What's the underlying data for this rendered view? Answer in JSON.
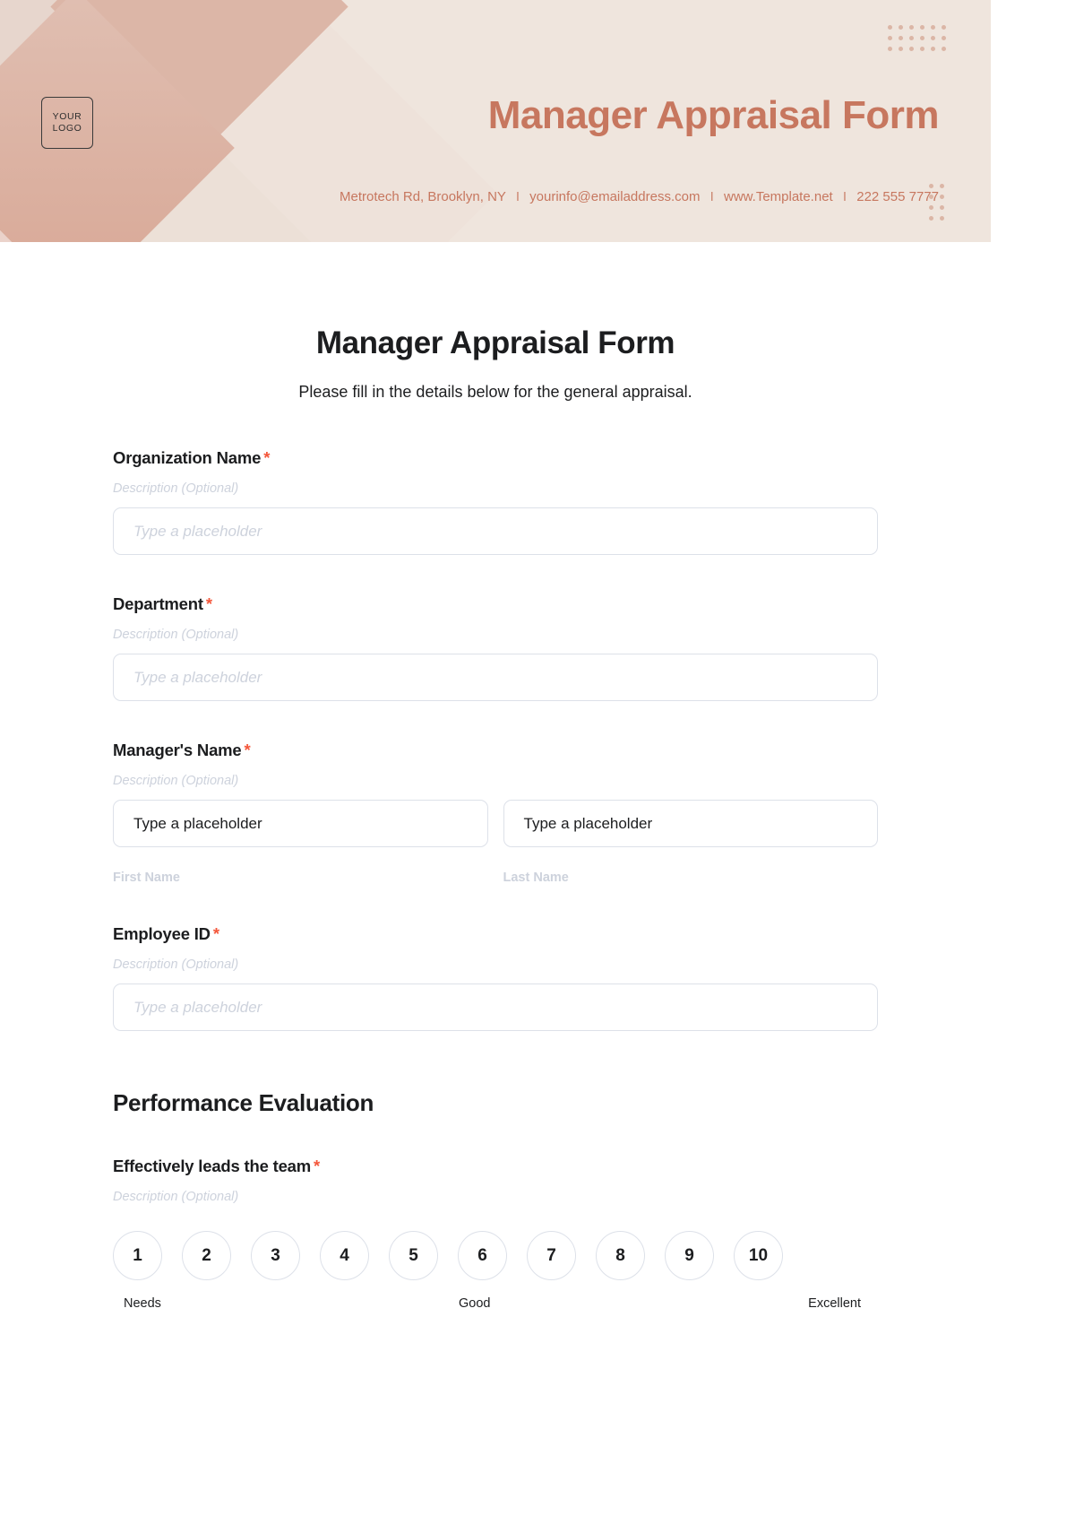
{
  "header": {
    "logo_line1": "YOUR",
    "logo_line2": "LOGO",
    "title": "Manager Appraisal Form",
    "contact": {
      "address": "Metrotech Rd, Brooklyn, NY",
      "email": "yourinfo@emailaddress.com",
      "website": "www.Template.net",
      "phone": "222 555 7777",
      "separator": "I"
    },
    "colors": {
      "accent": "#c7775f",
      "background": "#efe5de",
      "rose": "#ddb2a4",
      "dot": "#dbb6a6"
    }
  },
  "form": {
    "title": "Manager Appraisal Form",
    "subtitle": "Please fill in the details below for the general appraisal.",
    "required_marker": "*",
    "description_placeholder": "Description (Optional)",
    "fields": [
      {
        "label": "Organization Name",
        "required": true,
        "description": "Description (Optional)",
        "placeholder": "Type a placeholder"
      },
      {
        "label": "Department",
        "required": true,
        "description": "Description (Optional)",
        "placeholder": "Type a placeholder"
      },
      {
        "label": "Manager's Name",
        "required": true,
        "description": "Description (Optional)",
        "first_value": "Type a placeholder",
        "last_value": "Type a placeholder",
        "first_sublabel": "First Name",
        "last_sublabel": "Last Name"
      },
      {
        "label": "Employee ID",
        "required": true,
        "description": "Description (Optional)",
        "placeholder": "Type a placeholder"
      }
    ],
    "section": {
      "heading": "Performance Evaluation",
      "question": {
        "label": "Effectively leads the team",
        "required": true,
        "description": "Description (Optional)",
        "scale": [
          "1",
          "2",
          "3",
          "4",
          "5",
          "6",
          "7",
          "8",
          "9",
          "10"
        ],
        "legend_low": "Needs",
        "legend_mid": "Good",
        "legend_high": "Excellent"
      }
    },
    "colors": {
      "required": "#f4573b",
      "text": "#1c1d1f",
      "muted": "#cdd2dc",
      "border": "#dde1e9"
    }
  }
}
